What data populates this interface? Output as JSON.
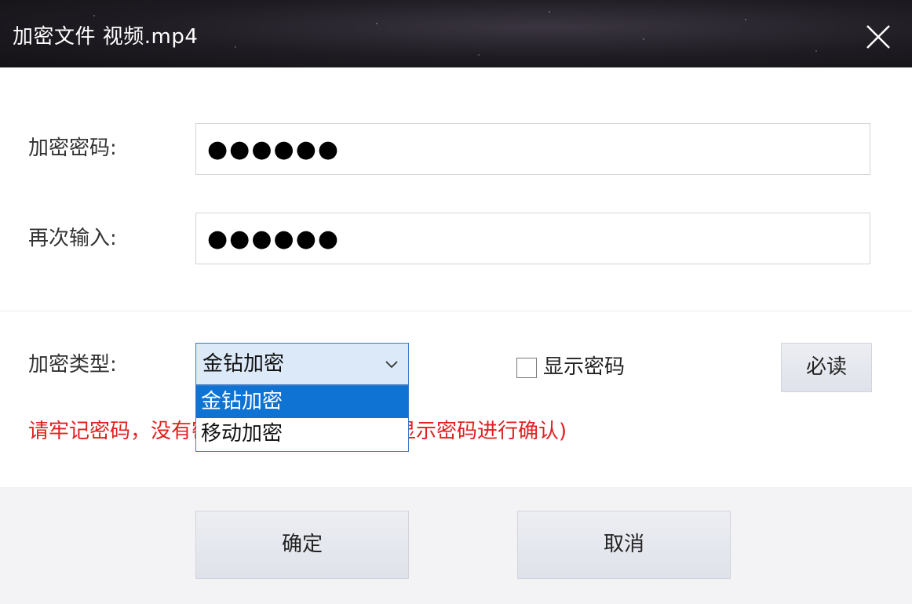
{
  "window": {
    "title": "加密文件 视频.mp4"
  },
  "form": {
    "password_label": "加密密码:",
    "password_value": "●●●●●●",
    "confirm_label": "再次输入:",
    "confirm_value": "●●●●●●",
    "type_label": "加密类型:",
    "type_selected": "金钻加密",
    "type_options": [
      "金钻加密",
      "移动加密"
    ],
    "show_password_label": "显示密码",
    "show_password_checked": false,
    "must_read_label": "必读",
    "warning_text": "请牢记密码，没有密码将无法解密（建议显示密码进行确认)"
  },
  "footer": {
    "ok_label": "确定",
    "cancel_label": "取消"
  },
  "colors": {
    "accent": "#0e73d2",
    "warning": "#e02020"
  }
}
